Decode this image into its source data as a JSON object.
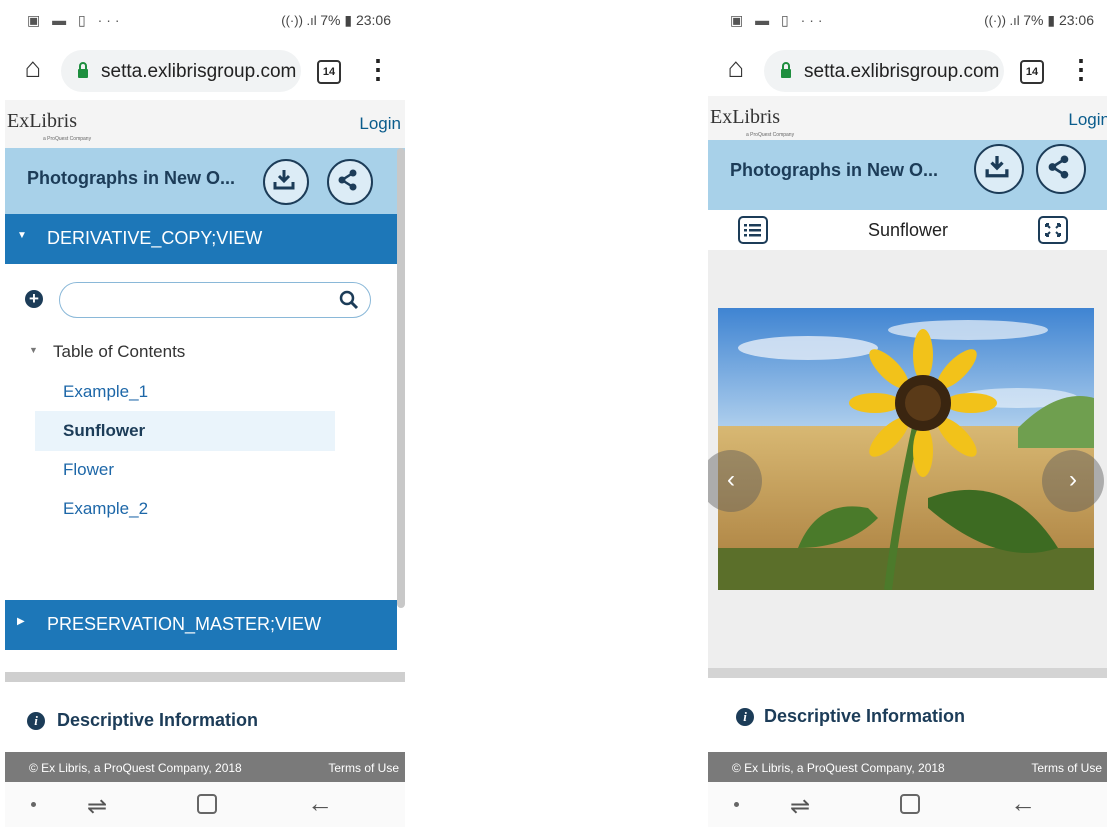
{
  "status": {
    "left_icons": "▣ ▬ ▯ ···",
    "right_info": "7% ▮ 23:06"
  },
  "browser": {
    "url": "setta.exlibrisgroup.com",
    "tab_count": "14"
  },
  "site": {
    "logo_text": "ExLibris",
    "logo_sub": "a ProQuest Company",
    "login_label": "Login",
    "title": "Photographs in New O..."
  },
  "left": {
    "section1": "DERIVATIVE_COPY;VIEW",
    "search_placeholder": "",
    "toc_title": "Table of Contents",
    "toc_items": [
      "Example_1",
      "Sunflower",
      "Flower",
      "Example_2"
    ],
    "section2": "PRESERVATION_MASTER;VIEW"
  },
  "right": {
    "viewer_title": "Sunflower"
  },
  "descriptive_label": "Descriptive Information",
  "footer": {
    "copyright": "© Ex Libris, a ProQuest Company, 2018",
    "terms": "Terms of Use"
  },
  "colors": {
    "primary_blue": "#1d77b8",
    "title_bar": "#a8d1e9",
    "dark_navy": "#1c3c58"
  },
  "icons": [
    "home-icon",
    "lock-icon",
    "tabs-icon",
    "more-vert-icon",
    "download-icon",
    "share-icon",
    "plus-icon",
    "search-icon",
    "info-icon",
    "list-icon",
    "fullscreen-icon",
    "chevron-left-icon",
    "chevron-right-icon"
  ]
}
